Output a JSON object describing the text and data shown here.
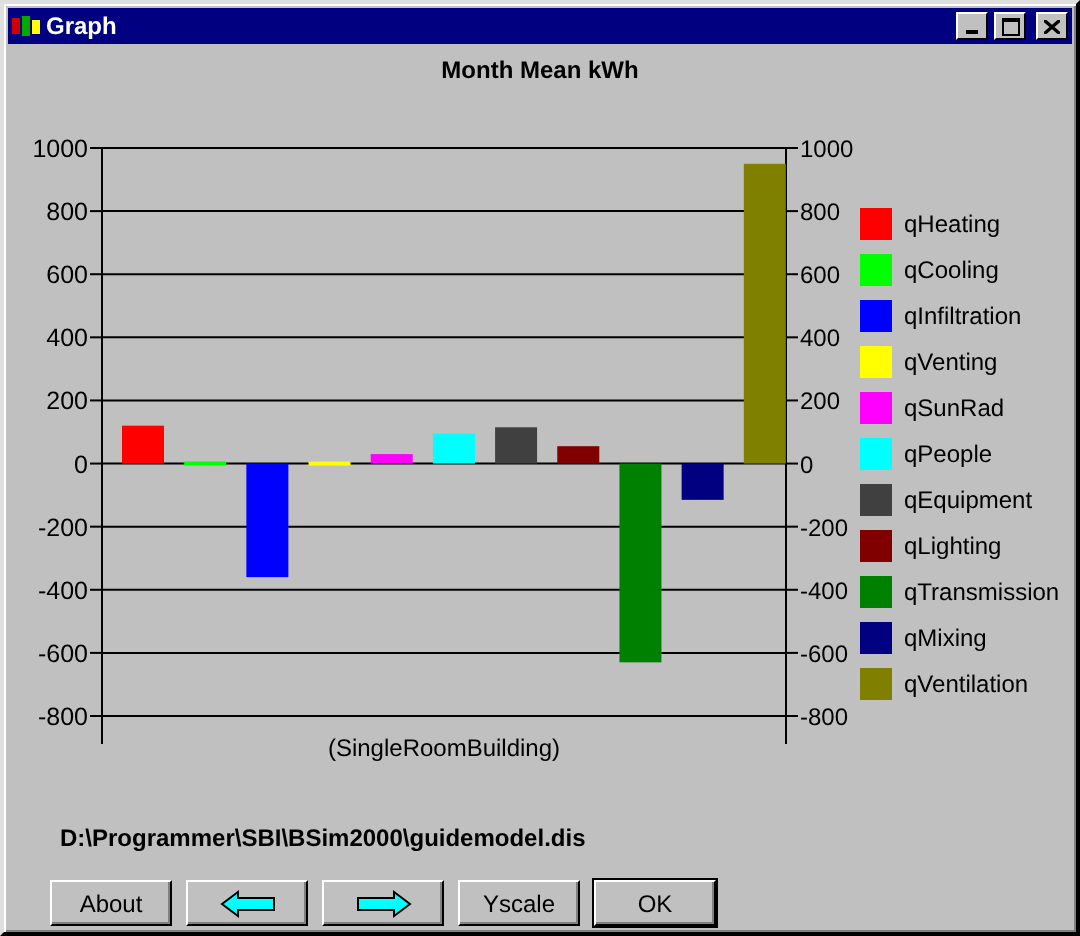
{
  "window": {
    "title": "Graph"
  },
  "chart": {
    "chart_data": {
      "type": "bar",
      "title": "Month Mean kWh",
      "xlabel": "(SingleRoomBuilding)",
      "ylim": [
        -800,
        1000
      ],
      "yticks": [
        -800,
        -600,
        -400,
        -200,
        0,
        200,
        400,
        600,
        800,
        1000
      ],
      "grid": true,
      "series": [
        {
          "name": "qHeating",
          "color": "#ff0000",
          "values": [
            120,
            null,
            null,
            null,
            null,
            null,
            null,
            null,
            null,
            null,
            null
          ]
        },
        {
          "name": "qCooling",
          "color": "#00ff00",
          "values": [
            null,
            -5,
            null,
            null,
            null,
            null,
            null,
            null,
            null,
            null,
            null
          ]
        },
        {
          "name": "qInfiltration",
          "color": "#0000ff",
          "values": [
            null,
            null,
            -360,
            null,
            null,
            null,
            null,
            null,
            null,
            null,
            null
          ]
        },
        {
          "name": "qVenting",
          "color": "#ffff00",
          "values": [
            null,
            null,
            null,
            -5,
            null,
            null,
            null,
            null,
            null,
            null,
            null
          ]
        },
        {
          "name": "qSunRad",
          "color": "#ff00ff",
          "values": [
            null,
            null,
            null,
            null,
            30,
            null,
            null,
            null,
            null,
            null,
            null
          ]
        },
        {
          "name": "qPeople",
          "color": "#00ffff",
          "values": [
            null,
            null,
            null,
            null,
            null,
            95,
            null,
            null,
            null,
            null,
            null
          ]
        },
        {
          "name": "qEquipment",
          "color": "#404040",
          "values": [
            null,
            null,
            null,
            null,
            null,
            null,
            115,
            null,
            null,
            null,
            null
          ]
        },
        {
          "name": "qLighting",
          "color": "#800000",
          "values": [
            null,
            null,
            null,
            null,
            null,
            null,
            null,
            55,
            null,
            null,
            null
          ]
        },
        {
          "name": "qTransmission",
          "color": "#008000",
          "values": [
            null,
            null,
            null,
            null,
            null,
            null,
            null,
            null,
            -630,
            null,
            null
          ]
        },
        {
          "name": "qMixing",
          "color": "#000080",
          "values": [
            null,
            null,
            null,
            null,
            null,
            null,
            null,
            null,
            null,
            -115,
            null
          ]
        },
        {
          "name": "qVentilation",
          "color": "#808000",
          "values": [
            null,
            null,
            null,
            null,
            null,
            null,
            null,
            null,
            null,
            null,
            950
          ]
        }
      ]
    },
    "right_axis_labels": [
      "1000",
      "800",
      "600",
      "400",
      "200",
      "0",
      "-200",
      "-400",
      "-600",
      "-800"
    ]
  },
  "file_path": "D:\\Programmer\\SBI\\BSim2000\\guidemodel.dis",
  "buttons": [
    {
      "kind": "text",
      "label": "About",
      "default": false
    },
    {
      "kind": "left-arrow",
      "default": false
    },
    {
      "kind": "right-arrow",
      "default": false
    },
    {
      "kind": "text",
      "label": "Yscale",
      "default": false
    },
    {
      "kind": "text",
      "label": "OK",
      "default": true
    }
  ]
}
